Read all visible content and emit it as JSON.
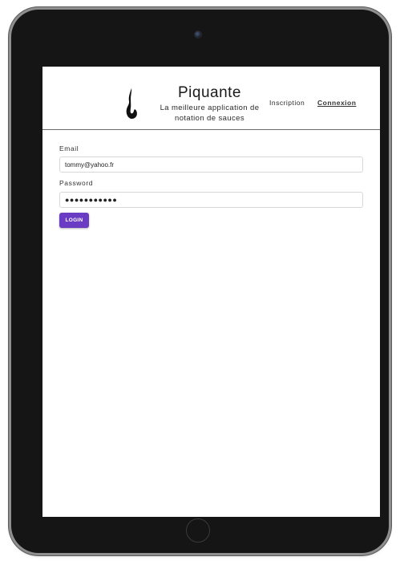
{
  "header": {
    "title": "Piquante",
    "subtitle": "La meilleure application de notation de sauces"
  },
  "nav": {
    "inscription": "Inscription",
    "connexion": "Connexion"
  },
  "form": {
    "email_label": "Email",
    "email_value": "tommy@yahoo.fr",
    "password_label": "Password",
    "password_value": "●●●●●●●●●●●",
    "login_label": "LOGIN"
  },
  "colors": {
    "accent": "#6a3bc3",
    "device_bezel": "#151515"
  },
  "icons": {
    "logo": "flame-icon"
  }
}
